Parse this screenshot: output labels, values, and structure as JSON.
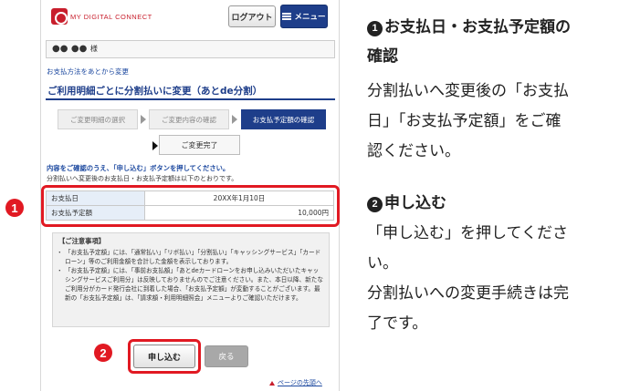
{
  "header": {
    "logo_text": "MY DIGITAL CONNECT",
    "logout_label": "ログアウト",
    "menu_label": "メニュー",
    "menu_icon": "list-icon"
  },
  "user": {
    "name": "●● ●●",
    "suffix": "様"
  },
  "breadcrumb": "お支払方法をあとから変更",
  "page_title": "ご利用明細ごとに分割払いに変更（あとde分割）",
  "steps": [
    {
      "label": "ご変更明細の選択",
      "active": false
    },
    {
      "label": "ご変更内容の確認",
      "active": false
    },
    {
      "label": "お支払予定額の確認",
      "active": true
    },
    {
      "label": "ご変更完了",
      "active": false
    }
  ],
  "notice": {
    "line1": "内容をご確認のうえ、「申し込む」ボタンを押してください。",
    "line2": "分割払いへ変更後のお支払日・お支払予定額は以下のとおりです。"
  },
  "info": {
    "rows": [
      {
        "label": "お支払日",
        "value": "20XX年1月10日"
      },
      {
        "label": "お支払予定額",
        "value": "10,000円"
      }
    ]
  },
  "caution": {
    "title": "【ご注意事項】",
    "items": [
      "「お支払予定額」には、「通常払い」「リボ払い」「分割払い」「キャッシングサービス」「カードローン」等のご利用金額を合計した金額を表示しております。",
      "「お支払予定額」には、「事前お支払額」「あとdeカードローンをお申し込みいただいたキャッシングサービスご利用分」は反映しておりませんのでご注意ください。また、本日以降、新たなご利用分がカード発行会社に到着した場合、「お支払予定額」が変動することがございます。最新の「お支払予定額」は、「請求額・利用明細照会」メニューよりご確認いただけます。"
    ]
  },
  "buttons": {
    "apply": "申し込む",
    "back": "戻る"
  },
  "page_top": "ページの先頭へ",
  "badges": {
    "one": "1",
    "two": "2"
  },
  "explain": {
    "section1": {
      "num": "1",
      "title_line1": "お支払日・お支払予定額の",
      "title_line2": "確認",
      "body": [
        "分割払いへ変更後の「お支払",
        "日」「お支払予定額」をご確",
        "認ください。"
      ]
    },
    "section2": {
      "num": "2",
      "title": "申し込む",
      "body": [
        "「申し込む」を押してくださ",
        "い。",
        "分割払いへの変更手続きは完",
        "了です。"
      ]
    }
  },
  "colors": {
    "accent_red": "#e11922",
    "navy": "#1e3e8a",
    "link_blue": "#1e4aa0"
  }
}
